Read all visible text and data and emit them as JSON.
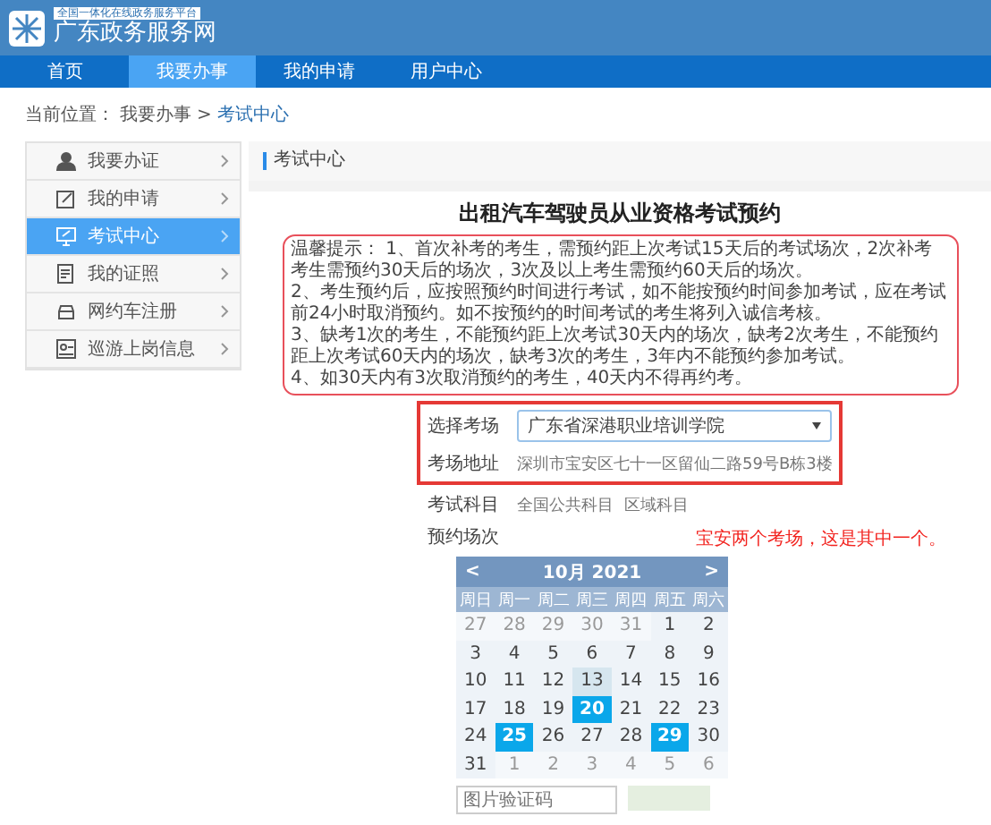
{
  "header": {
    "tagline": "全国一体化在线政务服务平台",
    "site_name": "广东政务服务网"
  },
  "nav": [
    {
      "label": "首页",
      "selected": false
    },
    {
      "label": "我要办事",
      "selected": true
    },
    {
      "label": "我的申请",
      "selected": false
    },
    {
      "label": "用户中心",
      "selected": false
    }
  ],
  "breadcrumb": {
    "prefix": "当前位置：",
    "parent": "我要办事",
    "separator": ">",
    "current": "考试中心"
  },
  "sidebar": {
    "items": [
      {
        "label": "我要办证",
        "selected": false
      },
      {
        "label": "我的申请",
        "selected": false
      },
      {
        "label": "考试中心",
        "selected": true
      },
      {
        "label": "我的证照",
        "selected": false
      },
      {
        "label": "网约车注册",
        "selected": false
      },
      {
        "label": "巡游上岗信息",
        "selected": false
      }
    ]
  },
  "panel_title": "考试中心",
  "page_title": "出租汽车驾驶员从业资格考试预约",
  "notice": [
    "温馨提示：  1、首次补考的考生，需预约距上次考试15天后的考试场次，2次补考考生需预约30天后的场次，3次及以上考生需预约60天后的场次。",
    "2、考生预约后，应按照预约时间进行考试，如不能按预约时间参加考试，应在考试前24小时取消预约。如不按预约的时间考试的考生将列入诚信考核。",
    "3、缺考1次的考生，不能预约距上次考试30天内的场次，缺考2次考生，不能预约距上次考试60天内的场次，缺考3次的考生，3年内不能预约参加考试。",
    "4、如30天内有3次取消预约的考生，40天内不得再约考。"
  ],
  "venue": {
    "label": "选择考场",
    "value": "广东省深港职业培训学院",
    "address_label": "考场地址",
    "address": "深圳市宝安区七十一区留仙二路59号B栋3楼"
  },
  "subjects": {
    "label": "考试科目",
    "items": [
      "全国公共科目",
      "区域科目"
    ]
  },
  "annotation": "宝安两个考场，这是其中一个。",
  "session_label": "预约场次",
  "calendar": {
    "prev": "<",
    "month": "10月 2021",
    "next": ">",
    "weekdays": [
      "周日",
      "周一",
      "周二",
      "周三",
      "周四",
      "周五",
      "周六"
    ],
    "weeks": [
      [
        {
          "label": "27",
          "kind": "other",
          "selected": false
        },
        {
          "label": "28",
          "kind": "other",
          "selected": false
        },
        {
          "label": "29",
          "kind": "other",
          "selected": false
        },
        {
          "label": "30",
          "kind": "other",
          "selected": false
        },
        {
          "label": "31",
          "kind": "other",
          "selected": false
        },
        {
          "label": "1",
          "kind": "day",
          "selected": false
        },
        {
          "label": "2",
          "kind": "day",
          "selected": false
        }
      ],
      [
        {
          "label": "3",
          "kind": "day",
          "selected": false
        },
        {
          "label": "4",
          "kind": "day",
          "selected": false
        },
        {
          "label": "5",
          "kind": "day",
          "selected": false
        },
        {
          "label": "6",
          "kind": "day",
          "selected": false
        },
        {
          "label": "7",
          "kind": "day",
          "selected": false
        },
        {
          "label": "8",
          "kind": "day",
          "selected": false
        },
        {
          "label": "9",
          "kind": "day",
          "selected": false
        }
      ],
      [
        {
          "label": "10",
          "kind": "day",
          "selected": false
        },
        {
          "label": "11",
          "kind": "day",
          "selected": false
        },
        {
          "label": "12",
          "kind": "day",
          "selected": false
        },
        {
          "label": "13",
          "kind": "today",
          "selected": false
        },
        {
          "label": "14",
          "kind": "day",
          "selected": false
        },
        {
          "label": "15",
          "kind": "day",
          "selected": false
        },
        {
          "label": "16",
          "kind": "day",
          "selected": false
        }
      ],
      [
        {
          "label": "17",
          "kind": "day",
          "selected": false
        },
        {
          "label": "18",
          "kind": "day",
          "selected": false
        },
        {
          "label": "19",
          "kind": "day",
          "selected": false
        },
        {
          "label": "20",
          "kind": "day",
          "selected": true
        },
        {
          "label": "21",
          "kind": "day",
          "selected": false
        },
        {
          "label": "22",
          "kind": "day",
          "selected": false
        },
        {
          "label": "23",
          "kind": "day",
          "selected": false
        }
      ],
      [
        {
          "label": "24",
          "kind": "day",
          "selected": false
        },
        {
          "label": "25",
          "kind": "day",
          "selected": true
        },
        {
          "label": "26",
          "kind": "day",
          "selected": false
        },
        {
          "label": "27",
          "kind": "day",
          "selected": false
        },
        {
          "label": "28",
          "kind": "day",
          "selected": false
        },
        {
          "label": "29",
          "kind": "day",
          "selected": true
        },
        {
          "label": "30",
          "kind": "day",
          "selected": false
        }
      ],
      [
        {
          "label": "31",
          "kind": "day",
          "selected": false
        },
        {
          "label": "1",
          "kind": "other",
          "selected": false
        },
        {
          "label": "2",
          "kind": "other",
          "selected": false
        },
        {
          "label": "3",
          "kind": "other",
          "selected": false
        },
        {
          "label": "4",
          "kind": "other",
          "selected": false
        },
        {
          "label": "5",
          "kind": "other",
          "selected": false
        },
        {
          "label": "6",
          "kind": "other",
          "selected": false
        }
      ]
    ]
  },
  "captcha": {
    "placeholder": "图片验证码"
  }
}
